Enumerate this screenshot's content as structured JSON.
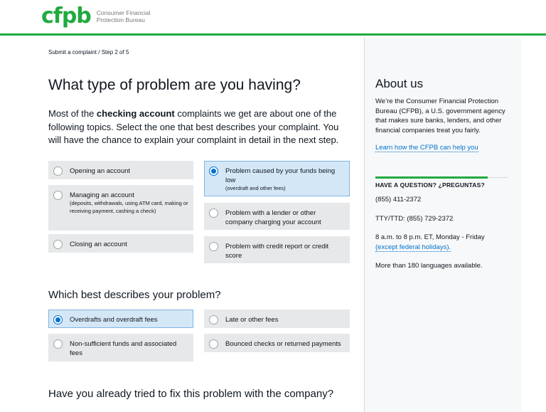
{
  "header": {
    "logo_mark": "cfpb",
    "logo_line1": "Consumer Financial",
    "logo_line2": "Protection Bureau"
  },
  "breadcrumb": "Submit a complaint  / Step 2 of 5",
  "page_title": "What type of problem are you having?",
  "intro": {
    "before": "Most of the ",
    "bold": "checking account",
    "after": " complaints we get are about one of the following topics. Select the one that best describes your complaint. You will have the chance to explain your complaint in detail in the next step."
  },
  "problem_types": [
    {
      "label": "Opening an account",
      "sub": "",
      "selected": false
    },
    {
      "label": "Managing an account",
      "sub": "(deposits, withdrawals, using ATM card, making or receiving payment, cashing a check)",
      "selected": false
    },
    {
      "label": "Closing an account",
      "sub": "",
      "selected": false
    },
    {
      "label": "Problem caused by your funds being low",
      "sub": "(overdraft and other fees)",
      "selected": true
    },
    {
      "label": "Problem with a lender or other company charging your account",
      "sub": "",
      "selected": false
    },
    {
      "label": "Problem with credit report or credit score",
      "sub": "",
      "selected": false
    }
  ],
  "subproblem_title": "Which best describes your problem?",
  "subproblems": [
    {
      "label": "Overdrafts and overdraft fees",
      "selected": true
    },
    {
      "label": "Late or other fees",
      "selected": false
    },
    {
      "label": "Non-sufficient funds and associated fees",
      "selected": false
    },
    {
      "label": "Bounced checks or returned payments",
      "selected": false
    }
  ],
  "fix_title": "Have you already tried to fix this problem with the company?",
  "sidebar": {
    "about_title": "About us",
    "about_text": "We’re the Consumer Financial Protection Bureau (CFPB), a U.S. government agency that makes sure banks, lenders, and other financial companies treat you fairly.",
    "learn_link": "Learn how the CFPB can help you",
    "question_heading": "HAVE A QUESTION? ¿PREGUNTAS?",
    "phone": "(855) 411-2372",
    "tty": "TTY/TTD: (855) 729-2372",
    "hours": "8 a.m. to 8 p.m. ET, Monday - Friday",
    "holidays_link": "(except federal holidays).",
    "languages": "More than 180 languages available."
  },
  "colors": {
    "brand_green": "#20aa3f",
    "link_blue": "#0072ce",
    "selected_bg": "#d4e7f6",
    "option_bg": "#e7e8e9"
  }
}
